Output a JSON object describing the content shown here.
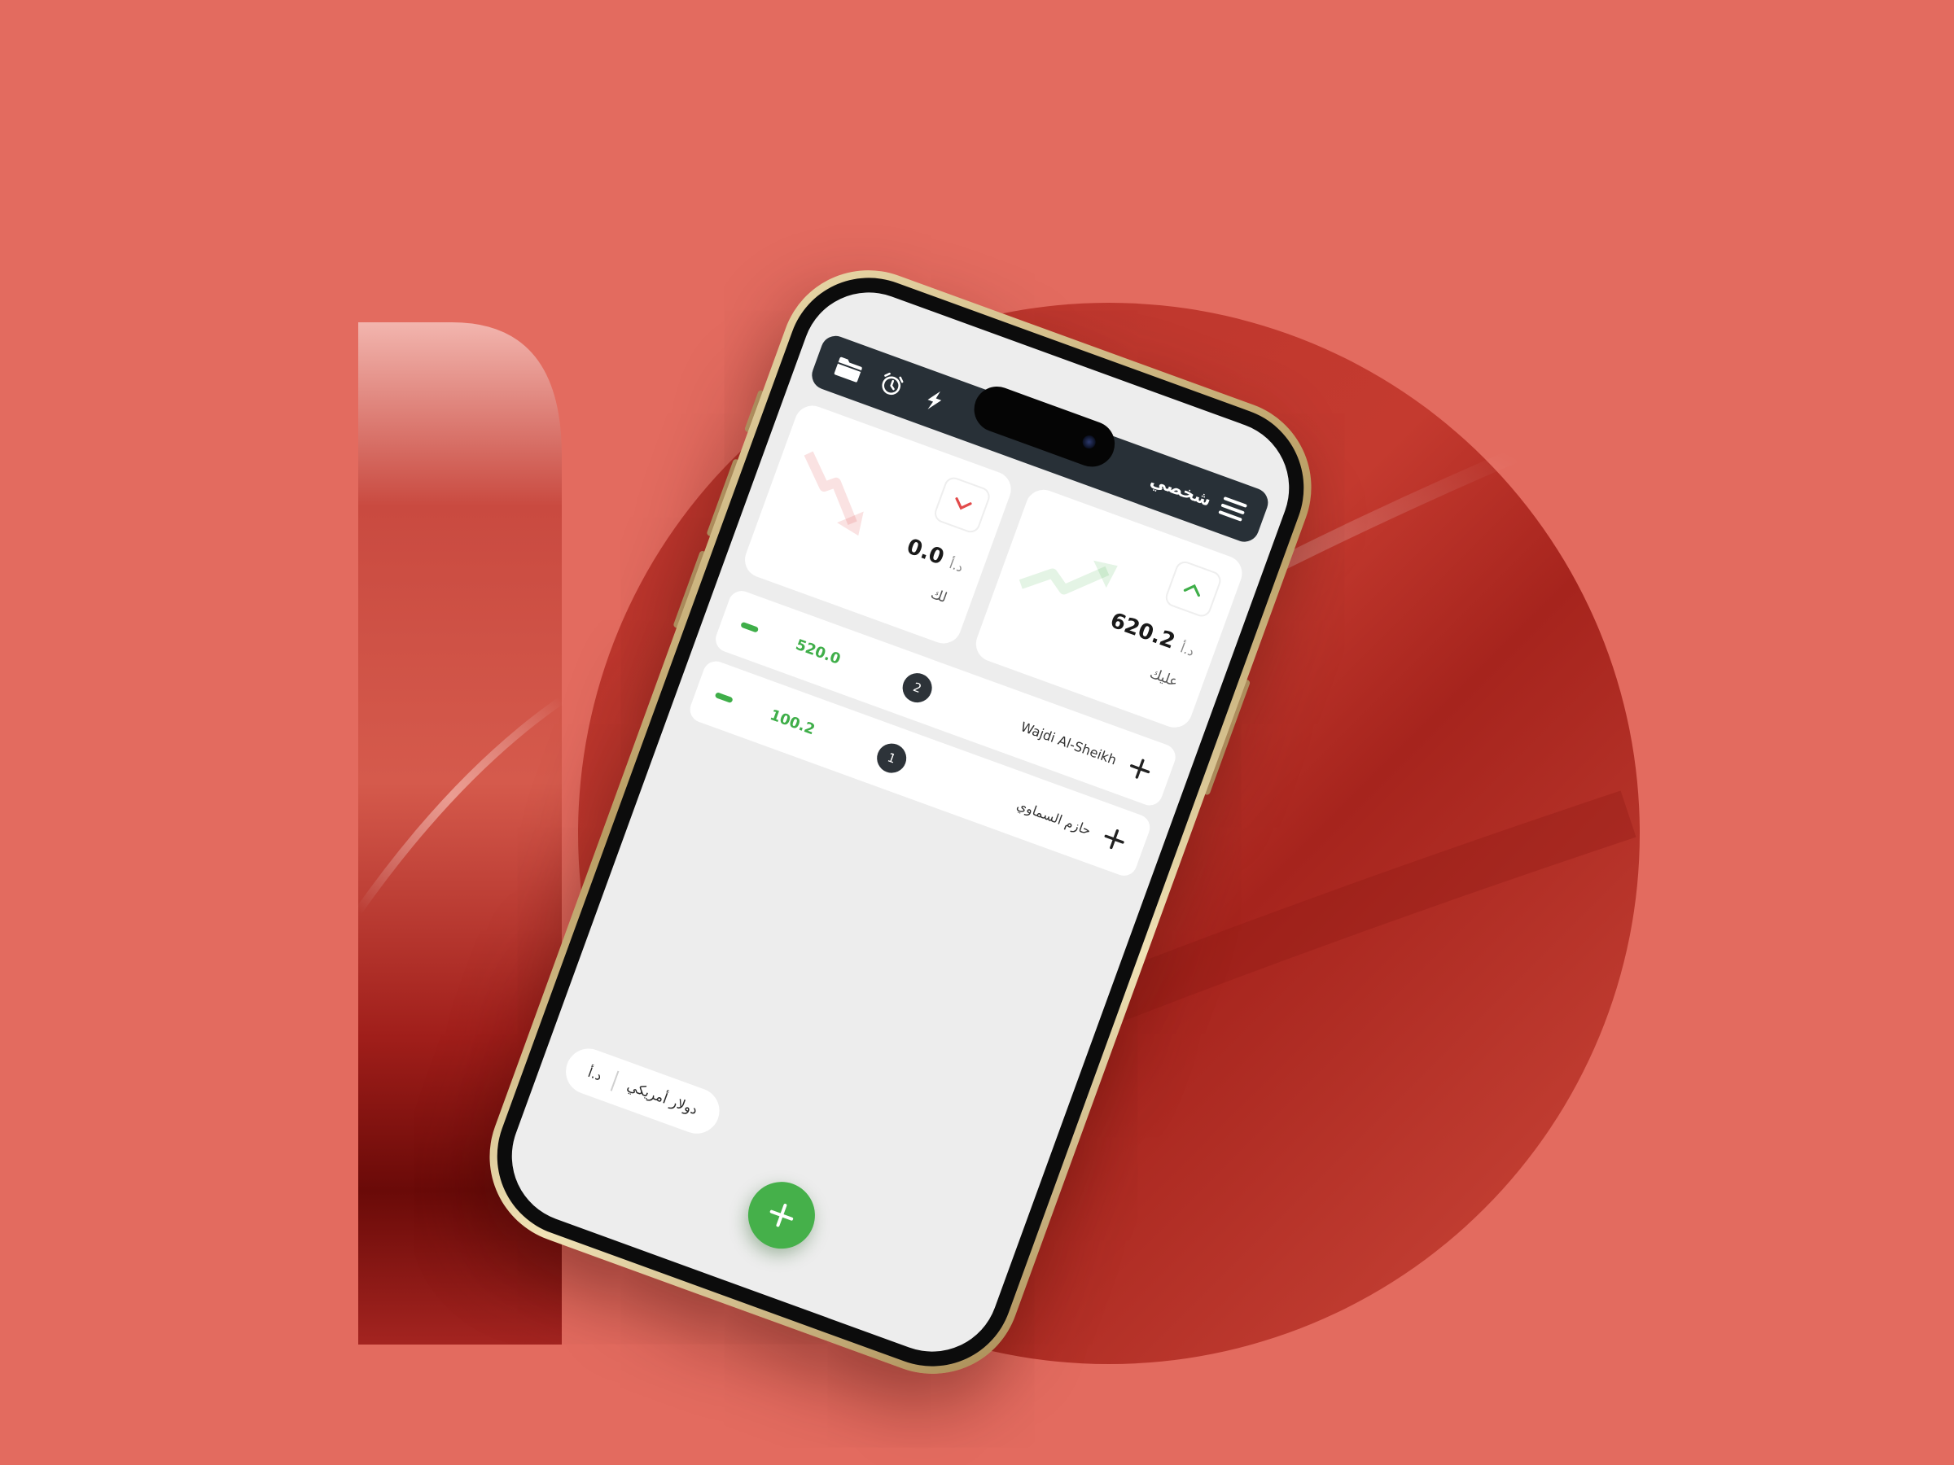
{
  "app": {
    "title": "شخصي",
    "icons": {
      "menu": "menu-icon",
      "folder": "folder-icon",
      "alarm": "alarm-clock-icon",
      "flash": "lightning-icon"
    }
  },
  "summary": {
    "owed_to_you": {
      "label": "لك",
      "value": "0.0",
      "currency": "د.أ",
      "trend": "down",
      "color": "#e24b4b"
    },
    "you_owe": {
      "label": "عليك",
      "value": "620.2",
      "currency": "د.أ",
      "trend": "up",
      "color": "#3fae49"
    }
  },
  "contacts": [
    {
      "name": "Wajdi Al-Sheikh",
      "count": "2",
      "amount": "520.0"
    },
    {
      "name": "حازم السماوي",
      "count": "1",
      "amount": "100.2"
    }
  ],
  "footer": {
    "currency_name": "دولار أمريكي",
    "currency_code": "د.أ",
    "fab_icon": "plus-icon"
  },
  "colors": {
    "background": "#e36b5f",
    "accent_green": "#45b04a",
    "accent_red": "#e24b4b",
    "appbar": "#283037"
  }
}
